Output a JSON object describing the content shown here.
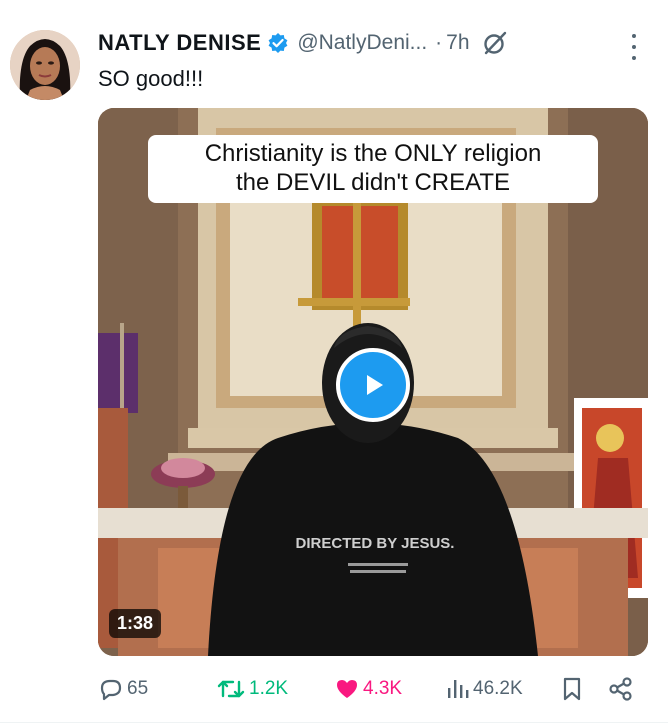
{
  "tweet": {
    "author_name": "NATLY DENISE",
    "handle": "@NatlyDeni...",
    "separator": "·",
    "time": "7h",
    "text": "SO good!!!"
  },
  "media": {
    "caption_line1": "Christianity is the ONLY religion",
    "caption_line2": "the DEVIL didn't CREATE",
    "duration": "1:38",
    "hoodie_text": "DIRECTED BY JESUS."
  },
  "actions": {
    "replies": "65",
    "reposts": "1.2K",
    "likes": "4.3K",
    "views": "46.2K"
  },
  "colors": {
    "accent": "#1d9bf0",
    "repost": "#00ba7c",
    "like": "#f91880",
    "muted": "#536471"
  },
  "icons": [
    "verified-badge-icon",
    "grok-icon",
    "more-icon",
    "play-icon",
    "reply-icon",
    "repost-icon",
    "like-icon",
    "views-icon",
    "bookmark-icon",
    "share-icon"
  ]
}
